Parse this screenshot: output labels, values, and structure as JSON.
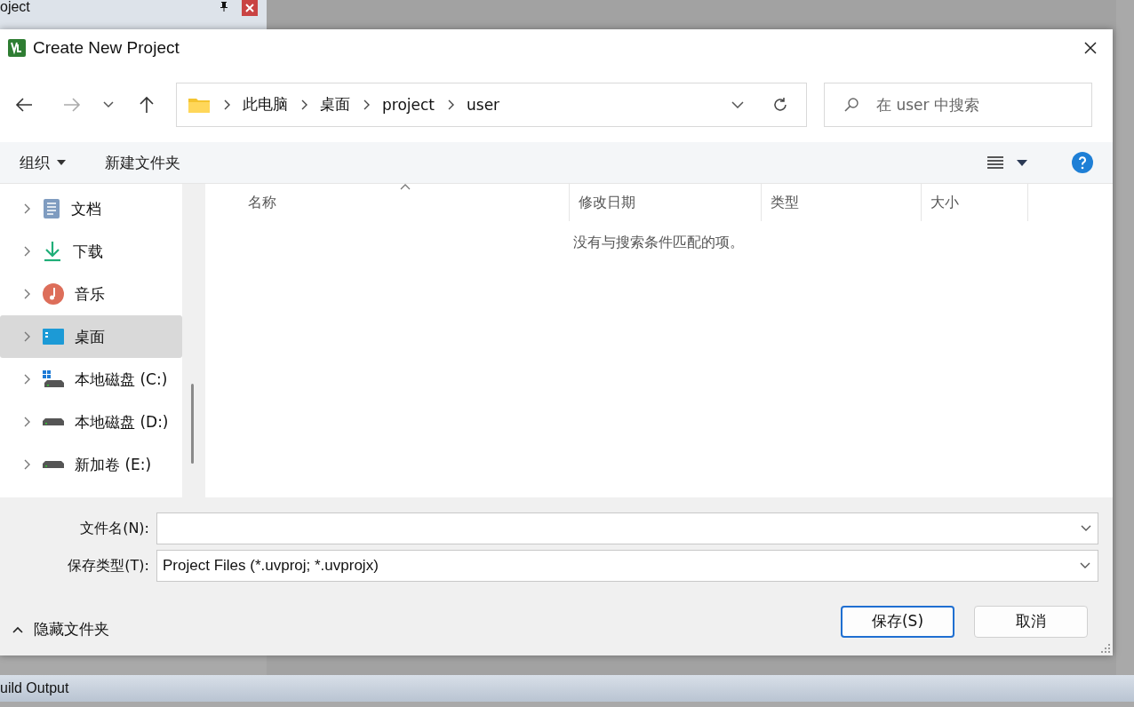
{
  "background": {
    "panel_title": "oject",
    "bottom_panel_title": "uild Output"
  },
  "dialog": {
    "title": "Create New Project",
    "breadcrumb": [
      "此电脑",
      "桌面",
      "project",
      "user"
    ],
    "search": {
      "placeholder": "在 user 中搜索"
    },
    "toolbar": {
      "organize": "组织",
      "new_folder": "新建文件夹"
    },
    "sidebar": [
      {
        "label": "文档",
        "kind": "document",
        "selected": false
      },
      {
        "label": "下载",
        "kind": "download",
        "selected": false
      },
      {
        "label": "音乐",
        "kind": "music",
        "selected": false
      },
      {
        "label": "桌面",
        "kind": "desktop",
        "selected": true
      },
      {
        "label": "本地磁盘 (C:)",
        "kind": "system-drive",
        "selected": false
      },
      {
        "label": "本地磁盘 (D:)",
        "kind": "drive",
        "selected": false
      },
      {
        "label": "新加卷 (E:)",
        "kind": "drive",
        "selected": false
      }
    ],
    "columns": [
      "名称",
      "修改日期",
      "类型",
      "大小"
    ],
    "empty_message": "没有与搜索条件匹配的项。",
    "filename": {
      "label": "文件名(N):"
    },
    "filetype": {
      "label": "保存类型(T):",
      "value": "Project Files (*.uvproj; *.uvprojx)"
    },
    "hide_folders": "隐藏文件夹",
    "buttons": [
      {
        "label": "保存(S)",
        "kind": "primary"
      },
      {
        "label": "取消",
        "kind": "normal"
      }
    ]
  }
}
